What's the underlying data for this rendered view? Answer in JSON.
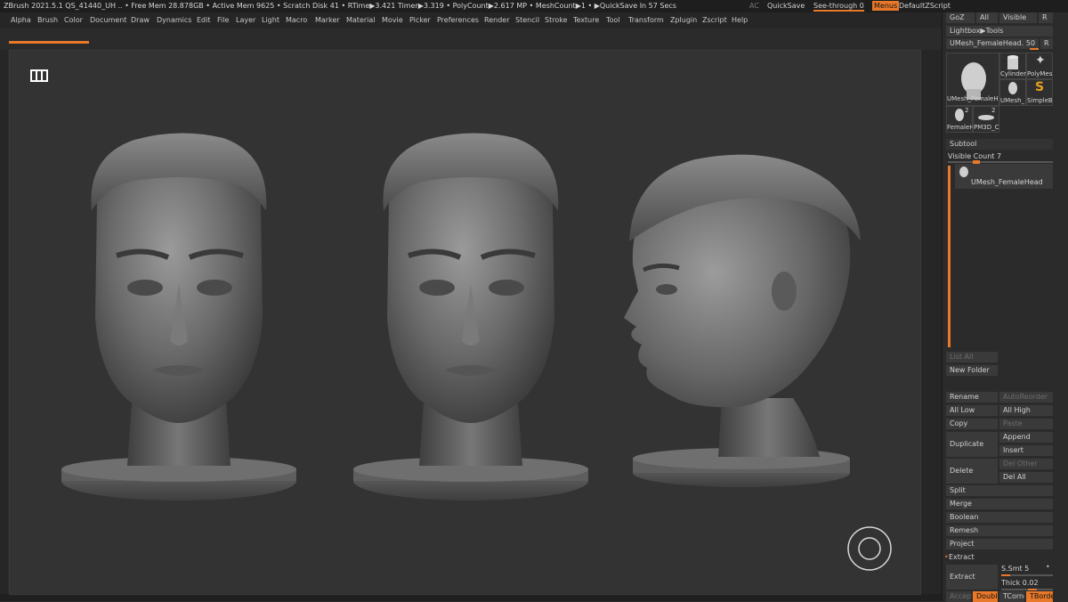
{
  "titlebar": {
    "text": "ZBrush 2021.5.1    QS_41440_UH   ..  • Free Mem 28.878GB • Active Mem 9625 • Scratch Disk 41 •  RTime▶3.421 Timer▶3.319 • PolyCount▶2.617 MP  • MeshCount▶1  • ▶QuickSave In 57 Secs",
    "ac": "AC",
    "quicksave": "QuickSave",
    "see_through": "See-through  0",
    "menus": "Menus",
    "default_zscript": "DefaultZScript"
  },
  "menubar": {
    "items": [
      "Alpha",
      "Brush",
      "Color",
      "Document",
      "Draw",
      "Dynamics",
      "Edit",
      "File",
      "Layer",
      "Light",
      "Macro",
      "Marker",
      "Material",
      "Movie",
      "Picker",
      "Preferences",
      "Render",
      "Stencil",
      "Stroke",
      "Texture",
      "Tool",
      "Transform",
      "Zplugin",
      "Zscript",
      "Help"
    ]
  },
  "right_panel": {
    "top_buttons": [
      "GoZ",
      "All",
      "Visible",
      "R"
    ],
    "lightbox_tools": "Lightbox▶Tools",
    "current_tool": "UMesh_FemaleHead. 50",
    "current_tool_r": "R",
    "tool_thumbs": {
      "main": "UMesh_FemaleH",
      "cylinder": "Cylinder",
      "polymesh": "PolyMes",
      "umesh": "UMesh_",
      "simpleb": "SimpleB",
      "femaleh": "FemaleH",
      "pm3d": "PM3D_C",
      "femaleh_count": "2",
      "pm3d_count": "2"
    },
    "subtool": {
      "header": "Subtool",
      "visible_count": "Visible Count 7",
      "item_name": "UMesh_FemaleHead",
      "list_all": "List All",
      "new_folder": "New Folder"
    },
    "buttons": {
      "rename": "Rename",
      "auto_reorder": "AutoReorder",
      "all_low": "All Low",
      "all_high": "All High",
      "copy": "Copy",
      "paste": "Paste",
      "duplicate": "Duplicate",
      "append": "Append",
      "insert": "Insert",
      "delete": "Delete",
      "del_other": "Del Other",
      "del_all": "Del All",
      "split": "Split",
      "merge": "Merge",
      "boolean": "Boolean",
      "remesh": "Remesh",
      "project": "Project",
      "extract_header": "Extract",
      "extract": "Extract",
      "s_smt": "S.Smt 5",
      "thick": "Thick 0.02",
      "accept": "Accept",
      "double": "Double",
      "tcorne": "TCorne",
      "tborder": "TBorde"
    }
  },
  "colors": {
    "accent": "#e8782a",
    "panel_bg": "#2b2b2b",
    "canvas_bg": "#333333"
  },
  "icons": [
    "viewport-icon",
    "gizmo-icon",
    "star-icon",
    "snake-icon"
  ]
}
